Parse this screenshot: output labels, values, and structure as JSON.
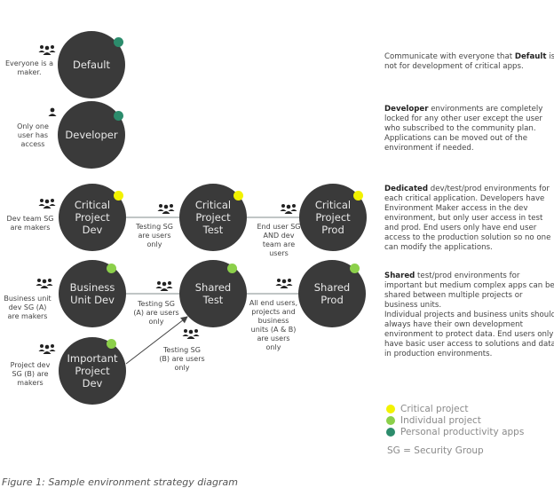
{
  "colors": {
    "critical": "#f2f200",
    "individual": "#8cd04a",
    "personal": "#2c8c6c",
    "node": "#3a3a3a"
  },
  "nodes": {
    "default": {
      "label": "Default",
      "type": "personal",
      "note": "Everyone is a\nmaker.",
      "icon": "group-icon"
    },
    "developer": {
      "label": "Developer",
      "type": "personal",
      "note": "Only one\nuser has\naccess",
      "icon": "user-icon"
    },
    "critical_dev": {
      "label": "Critical\nProject\nDev",
      "type": "critical",
      "note": "Dev team SG\nare makers",
      "icon": "group-icon"
    },
    "critical_test": {
      "label": "Critical\nProject\nTest",
      "type": "critical"
    },
    "critical_prod": {
      "label": "Critical\nProject\nProd",
      "type": "critical"
    },
    "business_dev": {
      "label": "Business\nUnit Dev",
      "type": "individual",
      "note": "Business unit\ndev SG (A)\nare makers",
      "icon": "group-icon"
    },
    "shared_test": {
      "label": "Shared\nTest",
      "type": "individual"
    },
    "shared_prod": {
      "label": "Shared\nProd",
      "type": "individual"
    },
    "important_dev": {
      "label": "Important\nProject\nDev",
      "type": "individual",
      "note": "Project dev\nSG (B) are\nmakers",
      "icon": "group-icon"
    }
  },
  "edges": {
    "critical_dev_test": "Testing SG\nare users\nonly",
    "critical_test_prod": "End user SG\nAND dev\nteam are\nusers",
    "business_shared_test": "Testing SG\n(A) are users\nonly",
    "important_shared_test": "Testing SG\n(B) are users\nonly",
    "shared_test_prod": "All end users,\nprojects and\nbusiness\nunits (A & B)\nare users\nonly"
  },
  "descriptions": {
    "default": {
      "pre": "Communicate with everyone that ",
      "bold": "Default",
      "post": " is not for development of critical apps."
    },
    "developer": {
      "bold": "Developer",
      "post": " environments are completely locked for any other user except the user who subscribed to the community plan. Applications can be moved out of the environment if needed."
    },
    "dedicated": {
      "bold": "Dedicated",
      "post": " dev/test/prod environments for each critical application. Developers have Environment Maker access in the dev environment, but only user access in test and prod. End users only have end user access to the production solution so no one can modify the applications."
    },
    "shared": {
      "bold": "Shared",
      "post": " test/prod environments for important but medium complex apps can be shared between multiple projects or business units.",
      "extra": "Individual projects and business units should always have their own development environment to protect data. End users only have basic user access to solutions and data in production environments."
    }
  },
  "legend": {
    "items": [
      {
        "label": "Critical project",
        "color": "#f2f200"
      },
      {
        "label": "Individual project",
        "color": "#8cd04a"
      },
      {
        "label": "Personal productivity apps",
        "color": "#2c8c6c"
      }
    ],
    "abbrev": "SG = Security Group"
  },
  "caption": "Figure 1: Sample environment strategy diagram"
}
